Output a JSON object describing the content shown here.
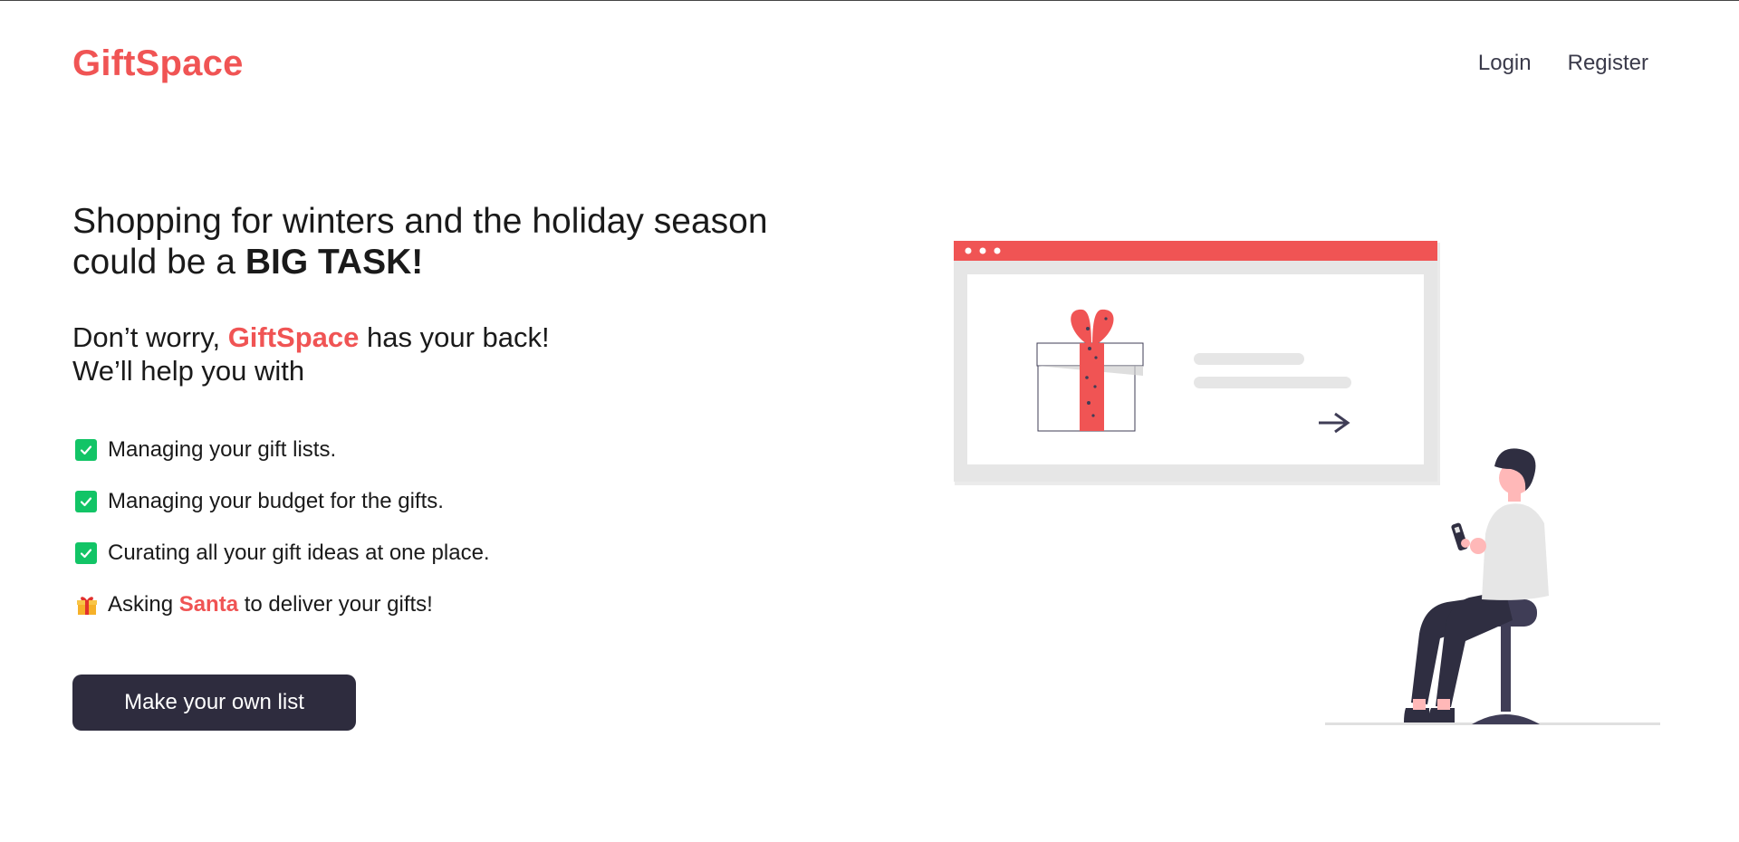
{
  "header": {
    "logo": "GiftSpace",
    "nav": {
      "login": "Login",
      "register": "Register"
    }
  },
  "hero": {
    "headline_line1": "Shopping for winters and the holiday season",
    "headline_line2_prefix": "could be a ",
    "headline_line2_bold": "BIG TASK!",
    "sub_line1_prefix": "Don’t worry, ",
    "sub_line1_brand": "GiftSpace",
    "sub_line1_suffix": " has your back!",
    "sub_line2": "We’ll help you with"
  },
  "features": [
    {
      "icon": "check-icon",
      "text": "Managing your gift lists."
    },
    {
      "icon": "check-icon",
      "text": "Managing your budget for the gifts."
    },
    {
      "icon": "check-icon",
      "text": "Curating all your gift ideas at one place."
    }
  ],
  "santa_feature": {
    "icon": "gift-icon",
    "prefix": "Asking ",
    "highlight": "Santa",
    "suffix": " to deliver your gifts!"
  },
  "cta": {
    "label": "Make your own list"
  },
  "colors": {
    "brand": "#f05454",
    "dark": "#2e2c3e",
    "check": "#12c466"
  }
}
